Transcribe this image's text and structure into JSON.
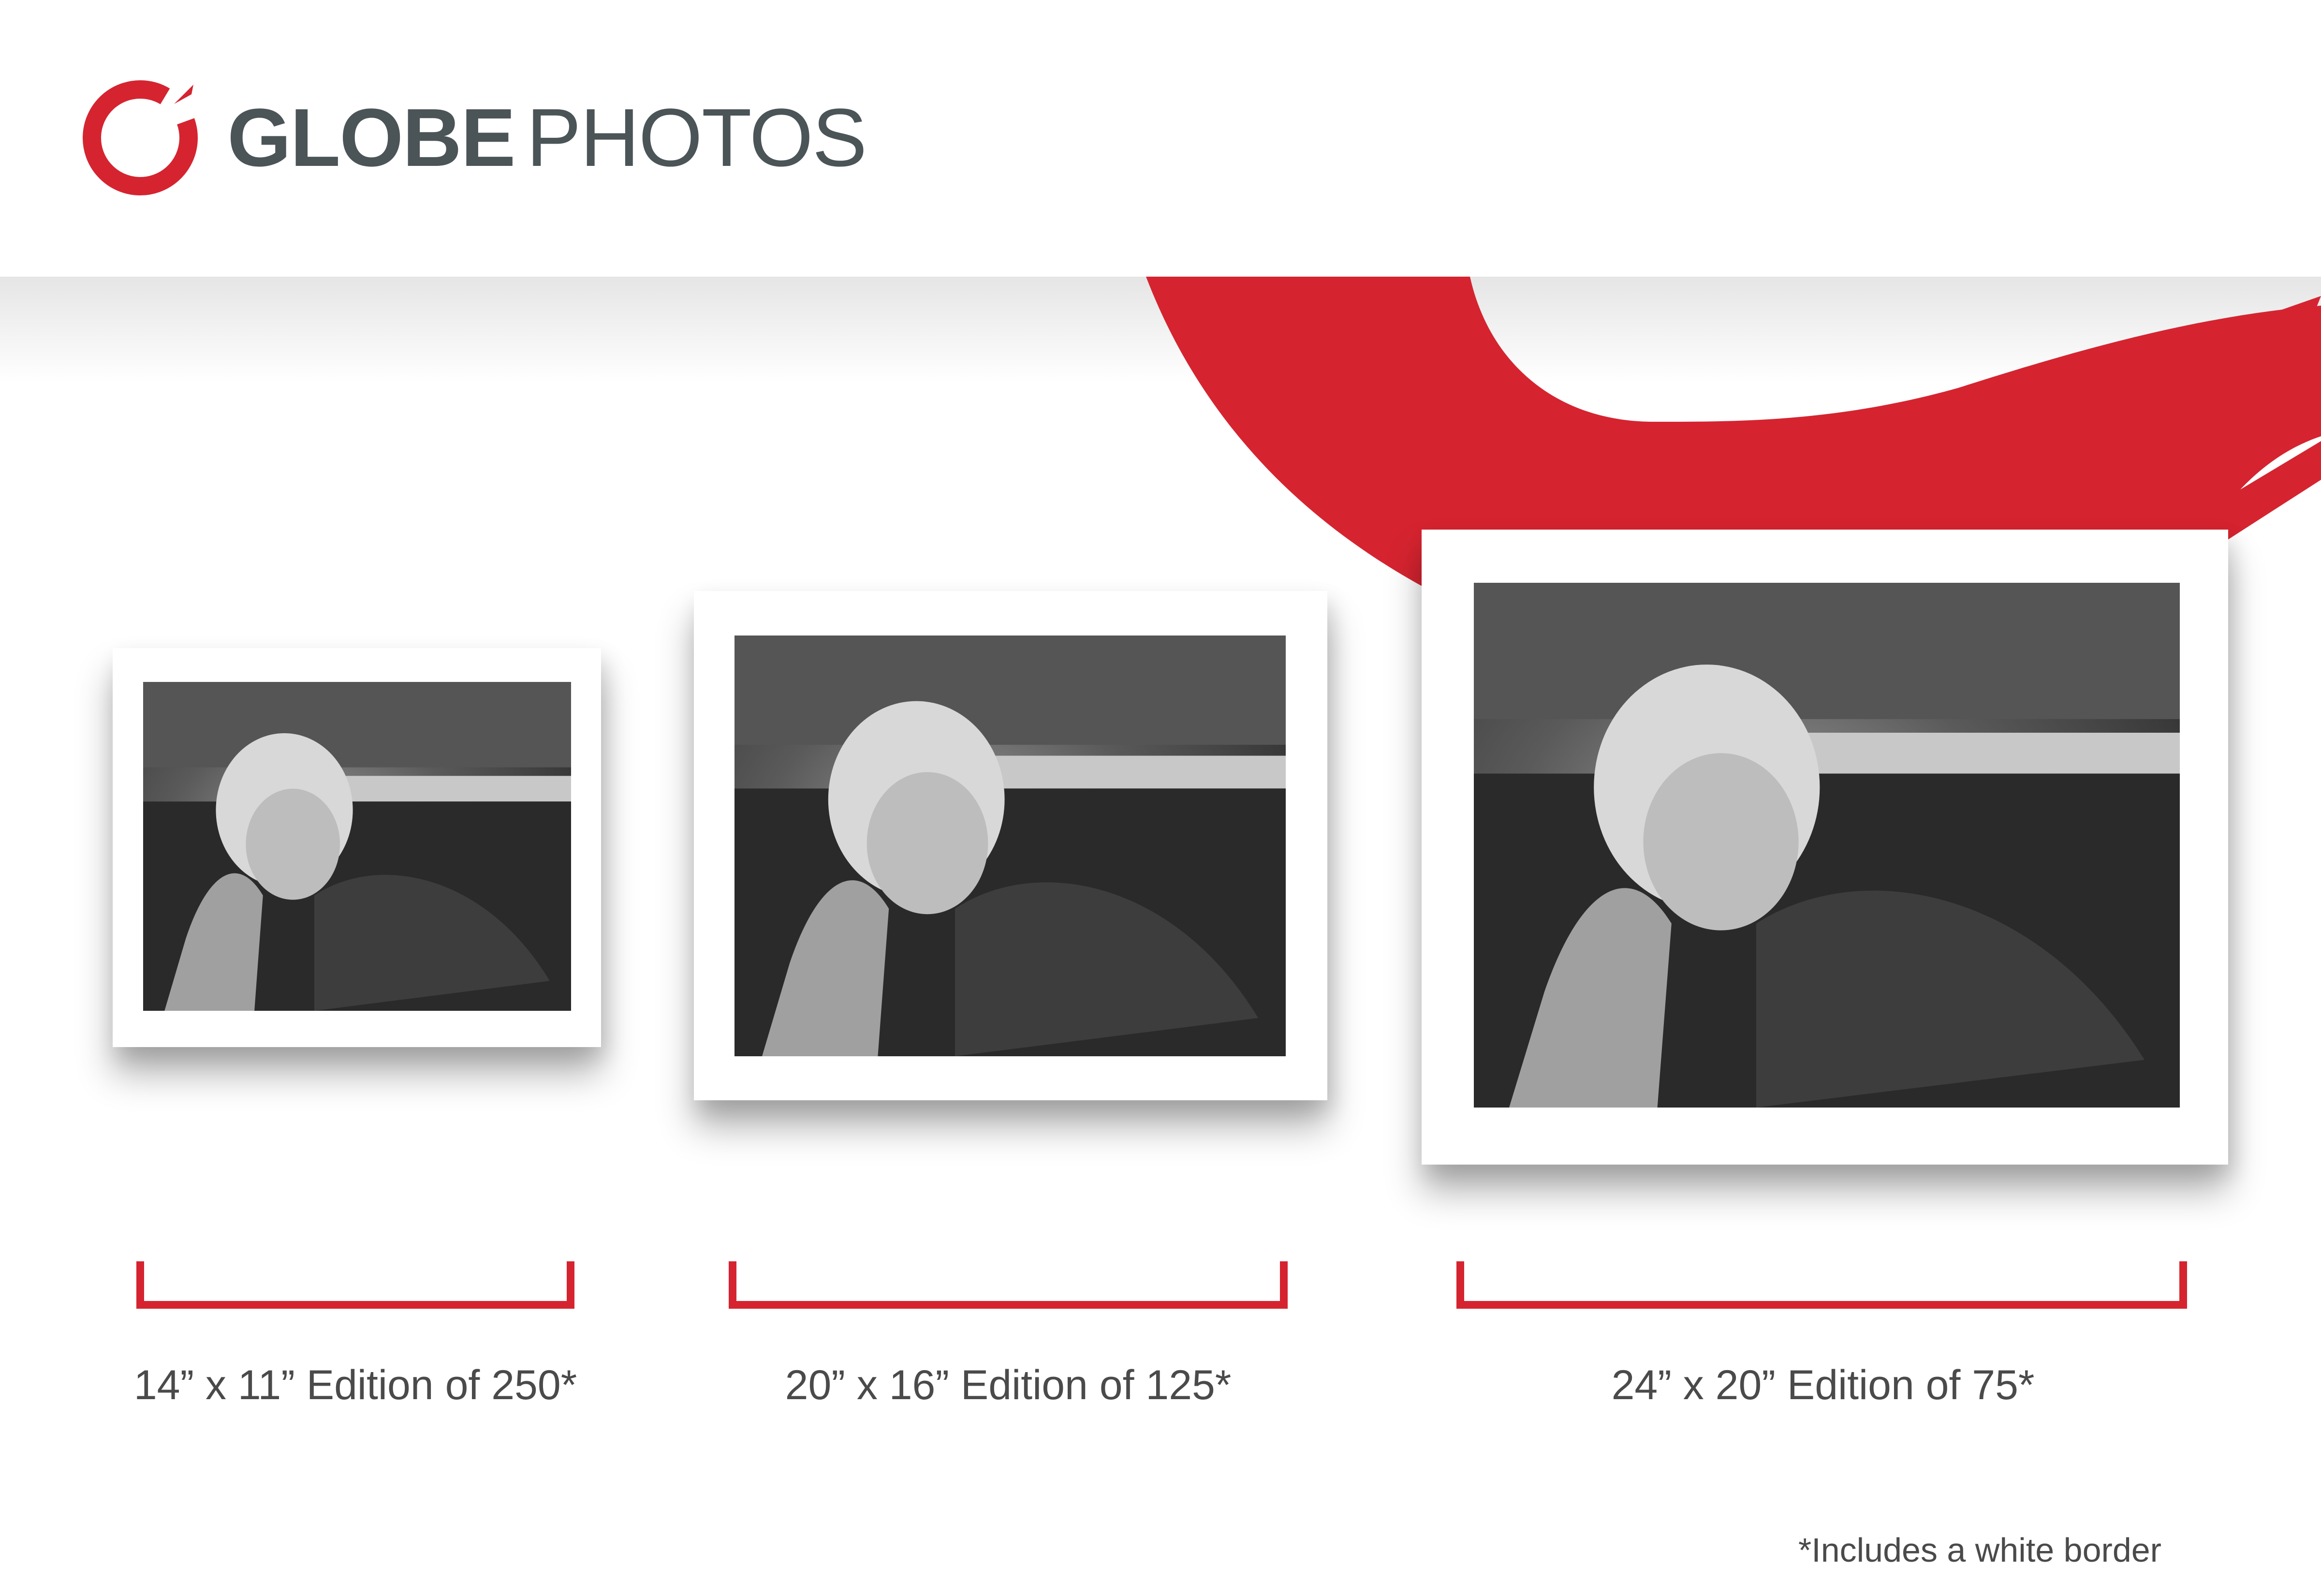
{
  "header": {
    "brand_bold": "GLOBE",
    "brand_light": "PHOTOS",
    "logo_icon": "brush-circle-icon"
  },
  "colors": {
    "brand_red": "#d52430",
    "brand_text": "#4b5457",
    "label_text": "#4a4a4a"
  },
  "prints": [
    {
      "label": "14” x 11” Edition of 250*",
      "image": "marilyn-photo"
    },
    {
      "label": "20” x 16” Edition of 125*",
      "image": "marilyn-photo"
    },
    {
      "label": "24” x 20” Edition of 75*",
      "image": "marilyn-photo"
    }
  ],
  "footnote": "*Includes a white border"
}
